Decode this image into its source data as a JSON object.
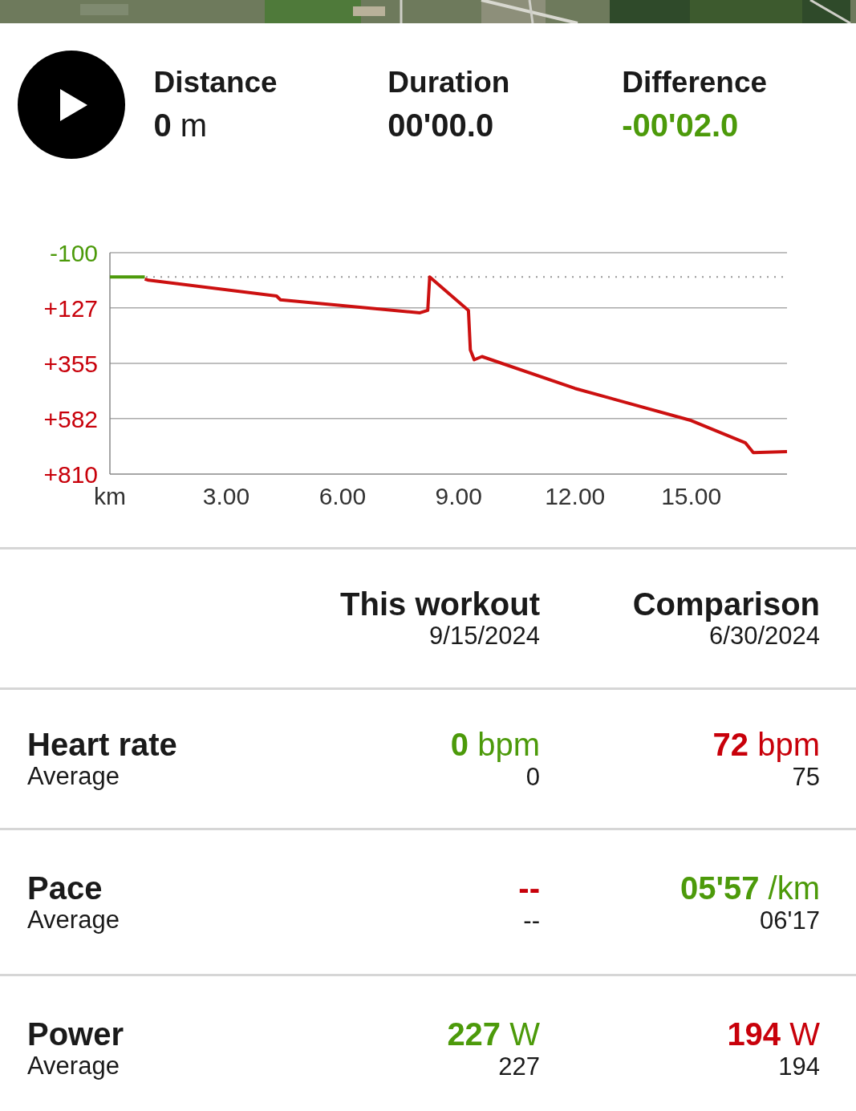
{
  "summary": {
    "stats": [
      {
        "label": "Distance",
        "value": "0",
        "unit": "m",
        "color": "#1a1a1a"
      },
      {
        "label": "Duration",
        "value": "00'00.0",
        "color": "#1a1a1a"
      },
      {
        "label": "Difference",
        "value": "-00'02.0",
        "color": "#4c9a0a"
      }
    ]
  },
  "chart": {
    "chart_data": {
      "type": "line",
      "grid": true,
      "ref_lines": [
        {
          "value": 0,
          "axis": "y"
        }
      ],
      "xlabel": "km",
      "xlim": [
        0,
        17.47
      ],
      "ylim": [
        810,
        -100
      ],
      "xticks": [
        {
          "value": 3,
          "label": "3.00"
        },
        {
          "value": 6,
          "label": "6.00"
        },
        {
          "value": 9,
          "label": "9.00"
        },
        {
          "value": 12,
          "label": "12.00"
        },
        {
          "value": 15,
          "label": "15.00"
        }
      ],
      "yticks": [
        {
          "value": -100,
          "label": "-100"
        },
        {
          "value": 127,
          "label": "+127"
        },
        {
          "value": 355,
          "label": "+355"
        },
        {
          "value": 582,
          "label": "+582"
        },
        {
          "value": 810,
          "label": "+810"
        }
      ],
      "x": [
        0,
        0.9,
        1,
        4.3,
        4.4,
        8,
        8.2,
        8.25,
        9.25,
        9.3,
        9.4,
        9.6,
        12,
        15,
        16.4,
        16.6,
        17.47
      ],
      "series": [
        {
          "color": "#4c9a0a",
          "values": [
            0,
            0,
            null,
            null,
            null,
            null,
            null,
            null,
            null,
            null,
            null,
            null,
            null,
            null,
            null,
            null,
            null
          ]
        },
        {
          "color": "#cc1010",
          "values": [
            null,
            8,
            13,
            78,
            94,
            147,
            137,
            0,
            137,
            300,
            340,
            327,
            458,
            590,
            682,
            722,
            718
          ]
        }
      ]
    }
  },
  "comparison": {
    "columns": [
      {
        "title": "This workout",
        "date": "9/15/2024"
      },
      {
        "title": "Comparison",
        "date": "6/30/2024"
      }
    ],
    "rows": [
      {
        "label": "Heart rate",
        "sublabel": "Average",
        "cells": [
          {
            "value": "**0** bpm",
            "color": "#4c9a0a",
            "average": "0"
          },
          {
            "value": "**72** bpm",
            "color": "#c8000a",
            "average": "75"
          }
        ]
      },
      {
        "label": "Pace",
        "sublabel": "Average",
        "cells": [
          {
            "value": "**--**",
            "color": "#c8000a",
            "average": "--"
          },
          {
            "value": "**05'57** /km",
            "color": "#4c9a0a",
            "average": "06'17"
          }
        ]
      },
      {
        "label": "Power",
        "sublabel": "Average",
        "cells": [
          {
            "value": "**227** W",
            "color": "#4c9a0a",
            "average": "227"
          },
          {
            "value": "**194** W",
            "color": "#c8000a",
            "average": "194"
          }
        ]
      }
    ]
  }
}
